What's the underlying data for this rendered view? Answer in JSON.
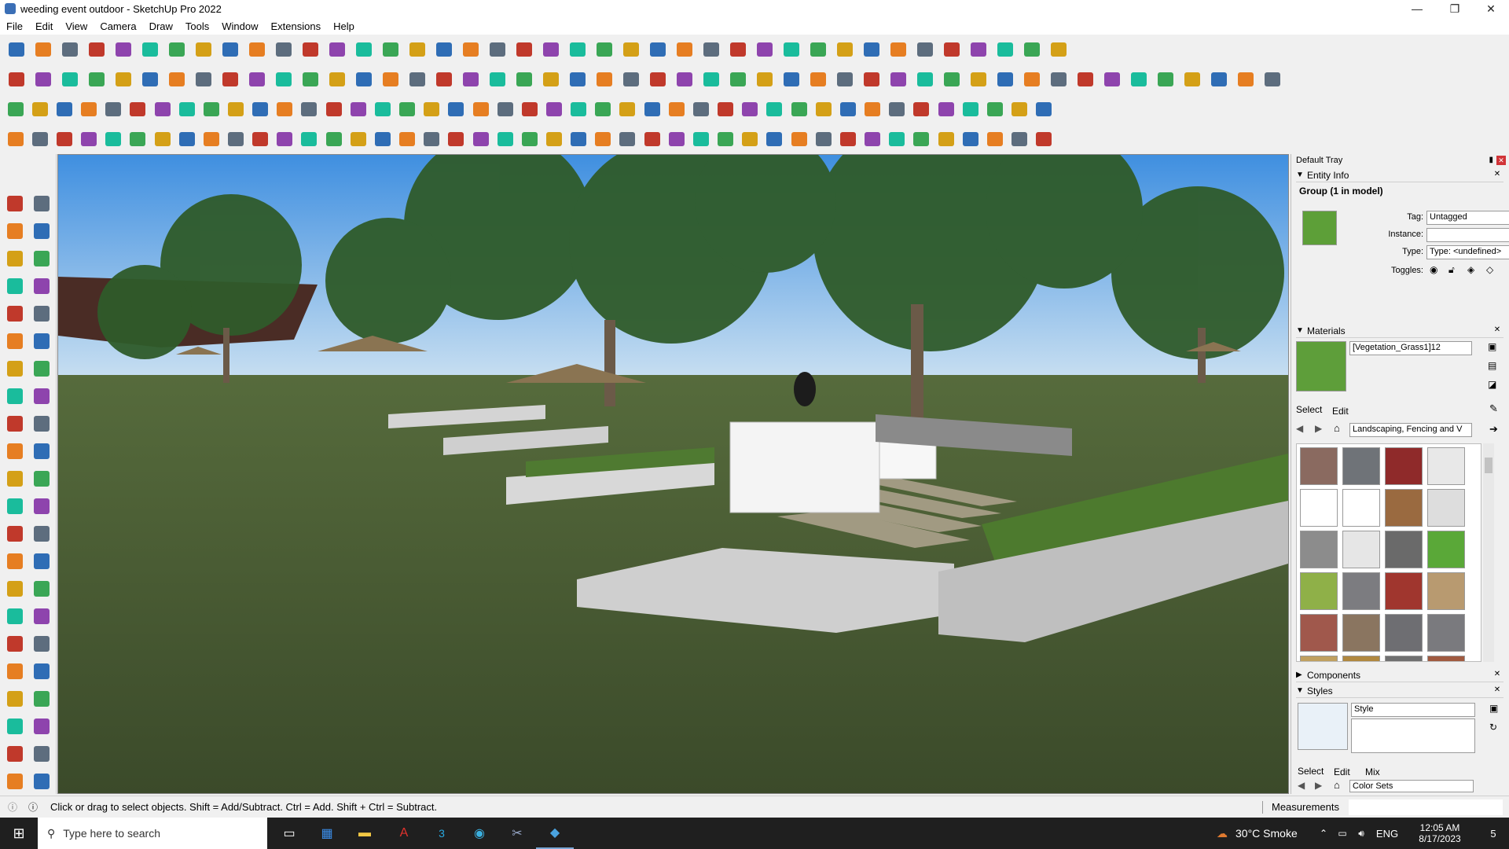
{
  "window": {
    "title": "weeding event outdoor - SketchUp Pro 2022",
    "minimize": "—",
    "maximize": "❐",
    "close": "✕"
  },
  "menubar": [
    "File",
    "Edit",
    "View",
    "Camera",
    "Draw",
    "Tools",
    "Window",
    "Extensions",
    "Help"
  ],
  "toolbar_palette": [
    "#2f6db5",
    "#c0392b",
    "#3aa655",
    "#e67e22",
    "#8e44ad",
    "#d4a017",
    "#5d6d7e",
    "#1abc9c"
  ],
  "tray": {
    "title": "Default Tray",
    "entity_info": {
      "header": "Entity Info",
      "object": "Group (1 in model)",
      "tag_label": "Tag:",
      "tag_value": "Untagged",
      "instance_label": "Instance:",
      "instance_value": "",
      "type_label": "Type:",
      "type_value": "Type: <undefined>",
      "toggles_label": "Toggles:"
    },
    "materials": {
      "header": "Materials",
      "material_name": "[Vegetation_Grass1]12",
      "tab_select": "Select",
      "tab_edit": "Edit",
      "collection": "Landscaping, Fencing and V",
      "swatch_colors": [
        "#8a6a60",
        "#6f7378",
        "#8f2a2a",
        "#e8e8e8",
        "#ffffff",
        "#ffffff",
        "#9a6a40",
        "#dddddd",
        "#8c8c8c",
        "#e6e6e6",
        "#6a6a6a",
        "#5aa838",
        "#8fb048",
        "#7c7c80",
        "#a0362e",
        "#b89a70",
        "#a0584c",
        "#8a7560",
        "#6e6e72",
        "#7a7a7e",
        "#c0a060",
        "#b08840",
        "#707070",
        "#a05a40"
      ]
    },
    "components": {
      "header": "Components"
    },
    "styles": {
      "header": "Styles",
      "style_name": "Style",
      "tab_select": "Select",
      "tab_edit": "Edit",
      "tab_mix": "Mix",
      "collection": "Color Sets"
    }
  },
  "statusbar": {
    "hint": "Click or drag to select objects. Shift = Add/Subtract. Ctrl = Add. Shift + Ctrl = Subtract.",
    "measurements_label": "Measurements"
  },
  "taskbar": {
    "search_placeholder": "Type here to search",
    "weather": "30°C  Smoke",
    "language": "ENG",
    "time": "12:05 AM",
    "date": "8/17/2023",
    "notifications": "5"
  }
}
